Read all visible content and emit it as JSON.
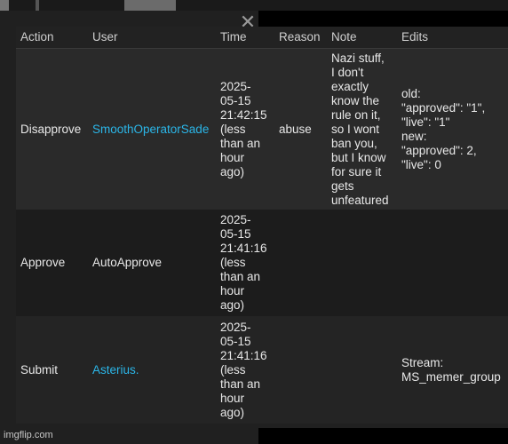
{
  "close_icon": "close-icon",
  "columns": [
    "Action",
    "User",
    "Time",
    "Reason",
    "Note",
    "Edits"
  ],
  "rows": [
    {
      "action": "Disapprove",
      "user": "SmoothOperatorSade",
      "time": "2025-\n05-15\n21:42:15\n(less\nthan an\nhour\nago)",
      "reason": "abuse",
      "note": "Nazi stuff,\nI don't\nexactly\nknow the\nrule on it,\nso I wont\nban you,\nbut I know\nfor sure it\ngets\nunfeatured",
      "edits": "old:\n\"approved\": \"1\",\n\"live\": \"1\"\nnew:\n\"approved\": 2,\n\"live\": 0"
    },
    {
      "action": "Approve",
      "user": "AutoApprove",
      "time": "2025-\n05-15\n21:41:16\n(less\nthan an\nhour\nago)",
      "reason": "",
      "note": "",
      "edits": ""
    },
    {
      "action": "Submit",
      "user": "Asterius.",
      "time": "2025-\n05-15\n21:41:16\n(less\nthan an\nhour\nago)",
      "reason": "",
      "note": "",
      "edits": "Stream:\nMS_memer_group"
    }
  ],
  "watermark": "imgflip.com",
  "colors": {
    "link": "#2bb6e8",
    "panel": "#202020"
  }
}
